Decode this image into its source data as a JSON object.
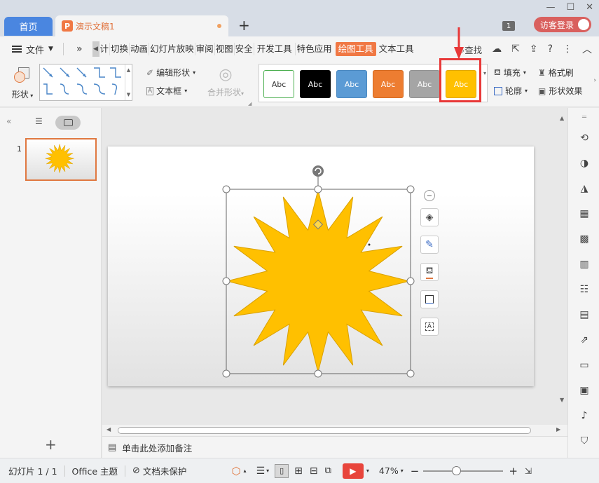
{
  "titlebar": {
    "home_tab": "首页",
    "doc_tab": "演示文稿1",
    "doc_icon": "P",
    "new_tab": "+",
    "notification_count": "1",
    "login_label": "访客登录",
    "window_controls": [
      "—",
      "☐",
      "✕"
    ]
  },
  "menubar": {
    "file_label": "文件",
    "more": "»",
    "items": [
      "计",
      "切换",
      "动画",
      "幻灯片放映",
      "审阅",
      "视图",
      "安全",
      "开发工具",
      "特色应用"
    ],
    "active_item": "绘图工具",
    "after_active": "文本工具",
    "search_label": "查找"
  },
  "ribbon": {
    "shape_label": "形状",
    "edit_shape": "编辑形状",
    "text_box": "文本框",
    "merge_shape": "合并形状",
    "style_sample": "Abc",
    "fill": "填充",
    "format_brush": "格式刷",
    "outline": "轮廓",
    "shape_effect": "形状效果"
  },
  "styles": [
    {
      "label": "Abc",
      "bg": "#ffffff",
      "fg": "#333333",
      "border": "#4caf50"
    },
    {
      "label": "Abc",
      "bg": "#000000",
      "fg": "#ffffff",
      "border": "#000000"
    },
    {
      "label": "Abc",
      "bg": "#5b9bd5",
      "fg": "#ffffff",
      "border": "#4a88c0"
    },
    {
      "label": "Abc",
      "bg": "#ed7d31",
      "fg": "#ffffff",
      "border": "#d46a20"
    },
    {
      "label": "Abc",
      "bg": "#a5a5a5",
      "fg": "#ffffff",
      "border": "#909090"
    },
    {
      "label": "Abc",
      "bg": "#ffc000",
      "fg": "#ffffff",
      "border": "#e0a800"
    }
  ],
  "slides_panel": {
    "slide_number": "1",
    "add": "+"
  },
  "shape": {
    "fill": "#ffc000",
    "stroke": "#d9a000"
  },
  "notes": {
    "placeholder": "单击此处添加备注"
  },
  "statusbar": {
    "slide_info": "幻灯片 1 / 1",
    "theme": "Office 主题",
    "protection": "文档未保护",
    "zoom": "47%"
  },
  "colors": {
    "accent": "#f07844",
    "highlight": "#e83838"
  }
}
